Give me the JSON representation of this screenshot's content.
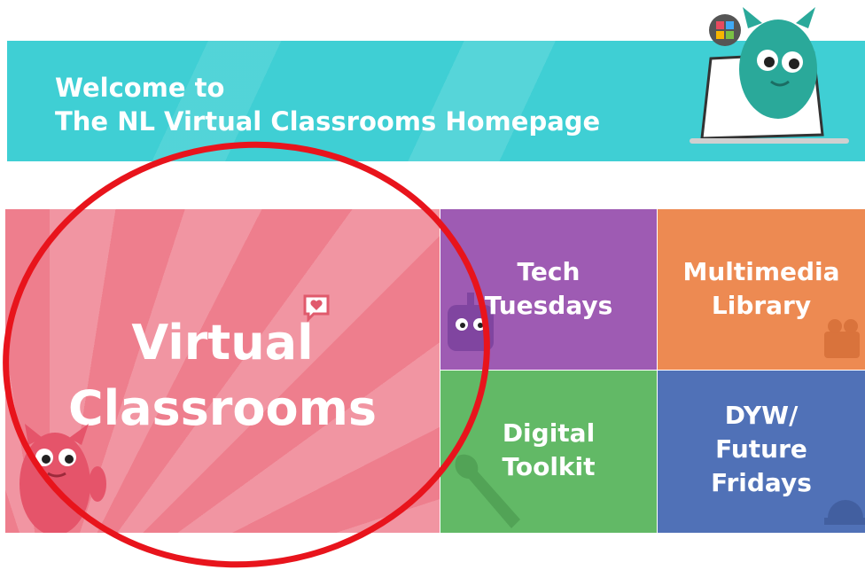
{
  "banner": {
    "line1": "Welcome to",
    "line2": "The NL Virtual Classrooms Homepage"
  },
  "tiles": {
    "virtual_classrooms": {
      "line1": "Virtual",
      "line2": "Classrooms",
      "color": "#ee7e8d"
    },
    "tech_tuesdays": {
      "line1": "Tech",
      "line2": "Tuesdays",
      "color": "#9e5bb3"
    },
    "multimedia_library": {
      "line1": "Multimedia",
      "line2": "Library",
      "color": "#ed8a52"
    },
    "digital_toolkit": {
      "line1": "Digital",
      "line2": "Toolkit",
      "color": "#62b966"
    },
    "dyw": {
      "line1": "DYW/",
      "line2": "Future",
      "line3": "Fridays",
      "color": "#5071b7"
    }
  },
  "colors": {
    "banner": "#3fcfd4",
    "annotation_circle": "#e8141c"
  },
  "icons": [
    "monster-mascot-icon",
    "laptop-icon",
    "chat-heart-icon",
    "robot-icon",
    "camera-icon",
    "wrench-icon",
    "hard-hat-icon"
  ]
}
